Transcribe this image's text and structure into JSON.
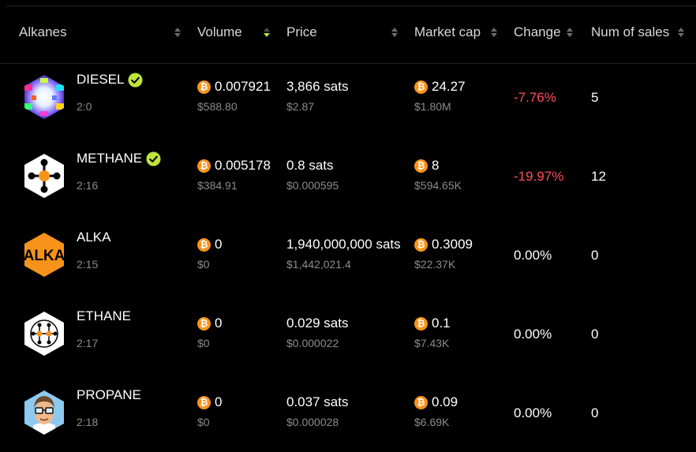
{
  "headers": {
    "alkanes": "Alkanes",
    "volume": "Volume",
    "price": "Price",
    "market_cap": "Market cap",
    "change": "Change",
    "num_sales": "Num of sales"
  },
  "sort_active": "volume-desc",
  "colors": {
    "negative": "#ff4d5a",
    "accent": "#bfe43a",
    "btc": "#f7931a"
  },
  "rows": [
    {
      "name": "DIESEL",
      "id": "2:0",
      "verified": true,
      "volume_btc": "0.007921",
      "volume_usd": "$588.80",
      "price": "3,866 sats",
      "price_usd": "$2.87",
      "mcap_btc": "24.27",
      "mcap_usd": "$1.80M",
      "change": "-7.76%",
      "sales": "5",
      "logo": "diesel-logo-icon"
    },
    {
      "name": "METHANE",
      "id": "2:16",
      "verified": true,
      "volume_btc": "0.005178",
      "volume_usd": "$384.91",
      "price": "0.8 sats",
      "price_usd": "$0.000595",
      "mcap_btc": "8",
      "mcap_usd": "$594.65K",
      "change": "-19.97%",
      "sales": "12",
      "logo": "methane-logo-icon"
    },
    {
      "name": "ALKA",
      "id": "2:15",
      "verified": false,
      "volume_btc": "0",
      "volume_usd": "$0",
      "price": "1,940,000,000 sats",
      "price_usd": "$1,442,021.4",
      "mcap_btc": "0.3009",
      "mcap_usd": "$22.37K",
      "change": "0.00%",
      "sales": "0",
      "logo": "alka-logo-icon",
      "logo_text": "ALKA"
    },
    {
      "name": "ETHANE",
      "id": "2:17",
      "verified": false,
      "volume_btc": "0",
      "volume_usd": "$0",
      "price": "0.029 sats",
      "price_usd": "$0.000022",
      "mcap_btc": "0.1",
      "mcap_usd": "$7.43K",
      "change": "0.00%",
      "sales": "0",
      "logo": "ethane-logo-icon"
    },
    {
      "name": "PROPANE",
      "id": "2:18",
      "verified": false,
      "volume_btc": "0",
      "volume_usd": "$0",
      "price": "0.037 sats",
      "price_usd": "$0.000028",
      "mcap_btc": "0.09",
      "mcap_usd": "$6.69K",
      "change": "0.00%",
      "sales": "0",
      "logo": "propane-logo-icon"
    }
  ],
  "btc_glyph": "₿"
}
